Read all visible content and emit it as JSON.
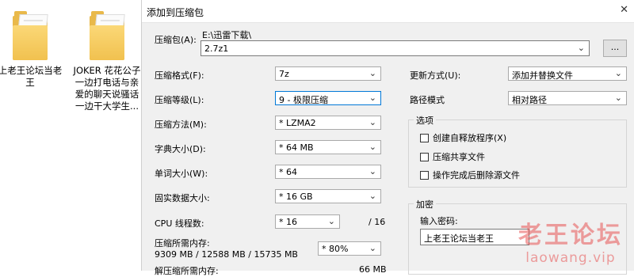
{
  "desktop": {
    "items": [
      {
        "label": "上老王论坛当老\n王"
      },
      {
        "label": "JOKER 花花公子\n一边打电话与亲\n爱的聊天说骚话\n一边干大学生..."
      }
    ]
  },
  "dialog": {
    "title": "添加到压缩包",
    "close_glyph": "✕",
    "archive": {
      "label": "压缩包(A):",
      "path": "E:\\迅雷下载\\",
      "filename": "2.7z1",
      "browse_label": "..."
    },
    "left": {
      "format": {
        "label": "压缩格式(F):",
        "value": "7z"
      },
      "level": {
        "label": "压缩等级(L):",
        "value": "9 - 极限压缩"
      },
      "method": {
        "label": "压缩方法(M):",
        "value": "* LZMA2"
      },
      "dict": {
        "label": "字典大小(D):",
        "value": "* 64 MB"
      },
      "word": {
        "label": "单词大小(W):",
        "value": "* 64"
      },
      "solid": {
        "label": "固实数据大小:",
        "value": "* 16 GB"
      },
      "threads": {
        "label": "CPU 线程数:",
        "value": "* 16",
        "max": "/ 16"
      },
      "memory": {
        "label": "压缩所需内存:",
        "detail": "9309 MB / 12588 MB / 15735 MB",
        "value": "* 80%"
      },
      "decomp": {
        "label": "解压缩所需内存:",
        "value": "66 MB"
      }
    },
    "right": {
      "update": {
        "label": "更新方式(U):",
        "value": "添加并替换文件"
      },
      "pathmode": {
        "label": "路径模式",
        "value": "相对路径"
      },
      "options": {
        "title": "选项",
        "items": [
          "创建自释放程序(X)",
          "压缩共享文件",
          "操作完成后删除源文件"
        ]
      },
      "encrypt": {
        "title": "加密",
        "password_label": "输入密码:",
        "password_value": "上老王论坛当老王"
      }
    }
  },
  "watermark": {
    "title": "老王论坛",
    "url": "laowang.vip"
  },
  "colors": {
    "dialog_bg": "#f0f0f0",
    "focus_border": "#0078d7",
    "watermark": "#e85454"
  }
}
